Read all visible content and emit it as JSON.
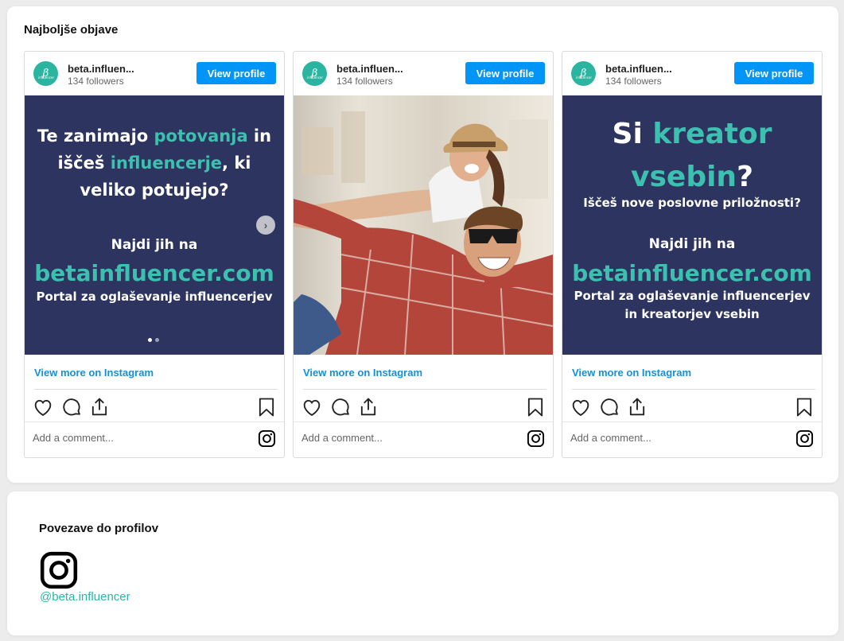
{
  "top_section": {
    "title": "Najboljše objave"
  },
  "posts": [
    {
      "username": "beta.influen...",
      "followers": "134 followers",
      "view_profile": "View profile",
      "view_more": "View more on Instagram",
      "comment_placeholder": "Add a comment...",
      "media": {
        "line1_a": "Te zanimajo ",
        "line1_b": "potovanja",
        "line1_c": " in",
        "line2_a": "iščeš ",
        "line2_b": "influencerje",
        "line2_c": ", ki",
        "line3": "veliko potujejo?",
        "line4": "Najdi jih na",
        "line5": "betainfluencer.com",
        "line6": "Portal za oglaševanje influencerjev"
      }
    },
    {
      "username": "beta.influen...",
      "followers": "134 followers",
      "view_profile": "View profile",
      "view_more": "View more on Instagram",
      "comment_placeholder": "Add a comment..."
    },
    {
      "username": "beta.influen...",
      "followers": "134 followers",
      "view_profile": "View profile",
      "view_more": "View more on Instagram",
      "comment_placeholder": "Add a comment...",
      "media": {
        "line1_a": "Si ",
        "line1_b": "kreator",
        "line2_a": "vsebin",
        "line2_b": "?",
        "line3": "Iščeš nove poslovne priložnosti?",
        "line4": "Najdi jih na",
        "line5": "betainfluencer.com",
        "line6": "Portal za oglaševanje influencerjev",
        "line7": "in kreatorjev vsebin"
      }
    }
  ],
  "bottom_section": {
    "title": "Povezave do profilov",
    "handle": "@beta.influencer"
  },
  "colors": {
    "accent": "#0095f6",
    "teal": "#3cc1b0",
    "navy": "#2d3460",
    "link": "#1490d8"
  },
  "icons": [
    "heart-icon",
    "comment-icon",
    "share-icon",
    "bookmark-icon",
    "instagram-icon",
    "chevron-right-icon"
  ]
}
